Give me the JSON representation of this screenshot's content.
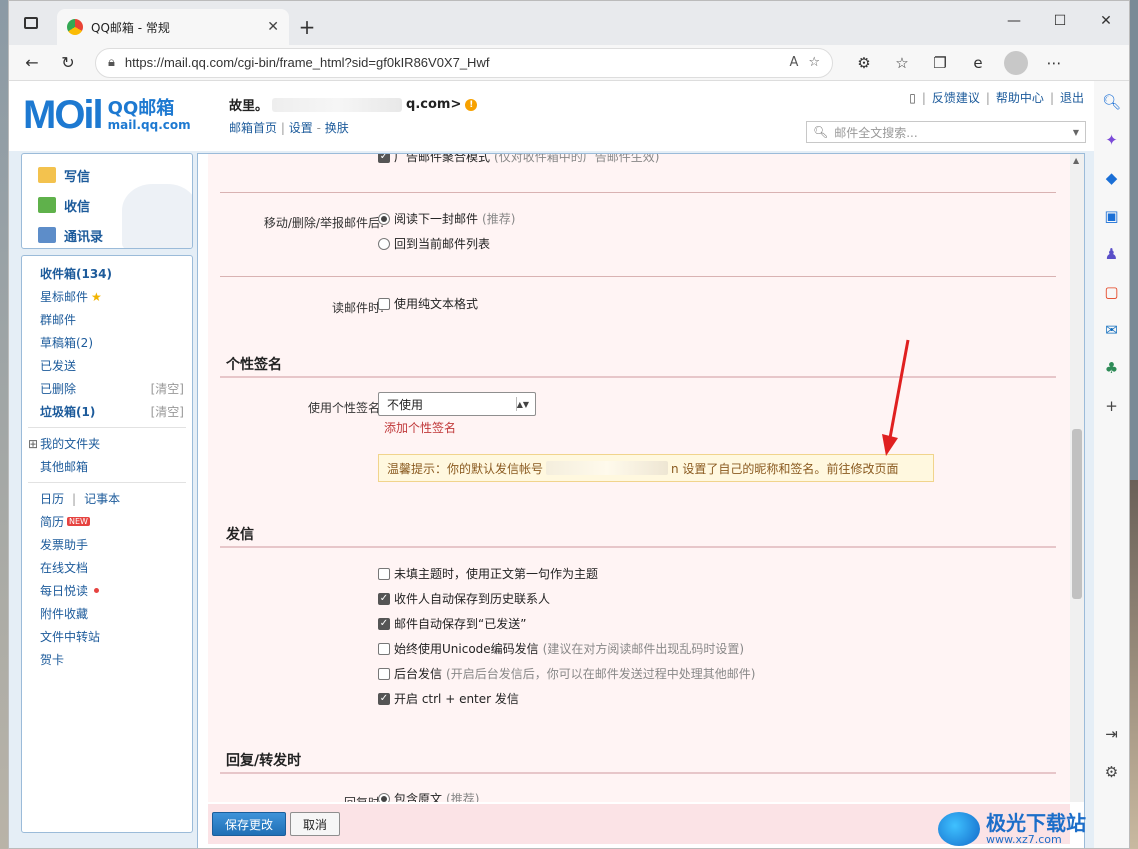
{
  "browser": {
    "tab_title": "QQ邮箱 - 常规",
    "url": "https://mail.qq.com/cgi-bin/frame_html?sid=gf0kIR86V0X7_Hwf"
  },
  "header": {
    "brand_name": "QQ邮箱",
    "brand_domain": "mail.qq.com",
    "user_name": "故里。",
    "user_email_suffix": "q.com>",
    "links": [
      "邮箱首页",
      "设置",
      "换肤"
    ],
    "top_links": [
      "反馈建议",
      "帮助中心",
      "退出"
    ],
    "search_placeholder": "邮件全文搜索..."
  },
  "compose": {
    "write": "写信",
    "receive": "收信",
    "contacts": "通讯录"
  },
  "folders": {
    "inbox": "收件箱(134)",
    "starred": "星标邮件",
    "group": "群邮件",
    "drafts": "草稿箱(2)",
    "sent": "已发送",
    "deleted": "已删除",
    "deleted_clear": "[清空]",
    "spam": "垃圾箱(1)",
    "spam_clear": "[清空]",
    "my_folders": "我的文件夹",
    "other_mail": "其他邮箱",
    "calendar": "日历",
    "notebook": "记事本",
    "resume": "简历",
    "resume_badge": "NEW",
    "invoice": "发票助手",
    "docs": "在线文档",
    "daily": "每日悦读",
    "attachments": "附件收藏",
    "transfer": "文件中转站",
    "cards": "贺卡"
  },
  "settings": {
    "top_cut_option": "广告邮件聚合模式",
    "top_cut_hint": "(仅对收件箱中的广告邮件生效)",
    "after_move_label": "移动/删除/举报邮件后:",
    "after_move_opt1": "阅读下一封邮件",
    "after_move_opt1_hint": "(推荐)",
    "after_move_opt2": "回到当前邮件列表",
    "read_label": "读邮件时:",
    "read_opt": "使用纯文本格式",
    "signature_section": "个性签名",
    "signature_label": "使用个性签名:",
    "signature_value": "不使用",
    "add_signature": "添加个性签名",
    "tip_prefix": "温馨提示：你的默认发信帐号",
    "tip_suffix": "n 设置了自己的昵称和签名。",
    "tip_link": "前往修改页面",
    "send_section": "发信",
    "send_opt1": "未填主题时，使用正文第一句作为主题",
    "send_opt2": "收件人自动保存到历史联系人",
    "send_opt3": "邮件自动保存到“已发送”",
    "send_opt4": "始终使用Unicode编码发信",
    "send_opt4_hint": "(建议在对方阅读邮件出现乱码时设置)",
    "send_opt5": "后台发信",
    "send_opt5_hint": "(开启后台发信后，你可以在邮件发送过程中处理其他邮件)",
    "send_opt6": "开启 ctrl + enter 发信",
    "reply_section": "回复/转发时",
    "reply_label": "回复时:",
    "reply_opt1": "包含原文",
    "reply_opt1_hint": "(推荐)"
  },
  "footer": {
    "save": "保存更改",
    "cancel": "取消"
  },
  "watermark": {
    "title": "极光下载站",
    "site": "www.xz7.com"
  },
  "colors": {
    "accent": "#1d79d1",
    "link": "#1d5b9b",
    "settings_bg": "#fff4f4",
    "arrow": "#e02020"
  }
}
